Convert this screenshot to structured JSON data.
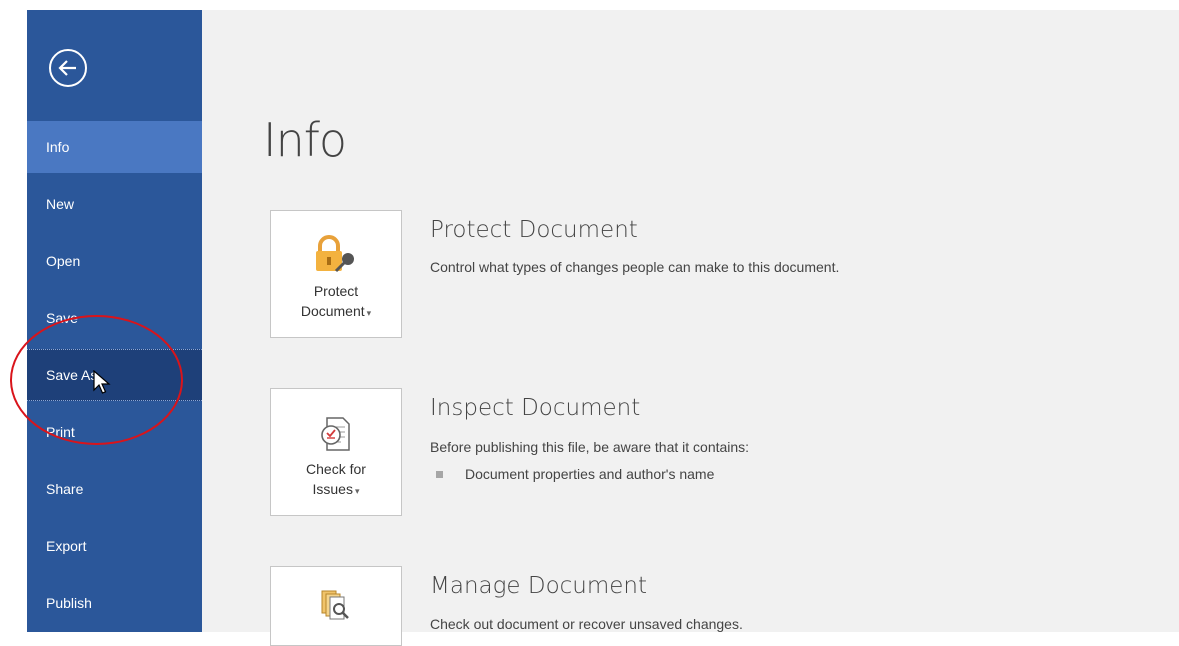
{
  "sidebar": {
    "items": [
      {
        "label": "Info",
        "state": "active"
      },
      {
        "label": "New",
        "state": "normal"
      },
      {
        "label": "Open",
        "state": "normal"
      },
      {
        "label": "Save",
        "state": "normal"
      },
      {
        "label": "Save As",
        "state": "hover"
      },
      {
        "label": "Print",
        "state": "normal"
      },
      {
        "label": "Share",
        "state": "normal"
      },
      {
        "label": "Export",
        "state": "normal"
      },
      {
        "label": "Publish",
        "state": "normal"
      }
    ],
    "back_icon": "back-arrow-icon"
  },
  "main": {
    "title": "Info",
    "sections": [
      {
        "tile_line1": "Protect",
        "tile_line2": "Document",
        "icon": "lock-key-icon",
        "title": "Protect Document",
        "description": "Control what types of changes people can make to this document."
      },
      {
        "tile_line1": "Check for",
        "tile_line2": "Issues",
        "icon": "inspect-document-icon",
        "title": "Inspect Document",
        "description": "Before publishing this file, be aware that it contains:",
        "bullets": [
          "Document properties and author's name"
        ]
      },
      {
        "icon": "manage-document-icon",
        "title": "Manage Document",
        "description": "Check out document or recover unsaved changes."
      }
    ]
  },
  "colors": {
    "sidebar": "#2b579a",
    "sidebar_active": "#4a78c2",
    "sidebar_hover": "#1e4079",
    "annotation": "#d9141b"
  }
}
